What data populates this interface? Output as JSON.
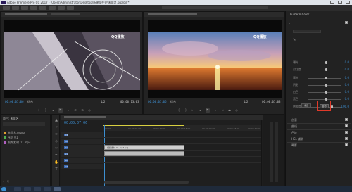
{
  "window": {
    "title": "Adobe Premiere Pro CC 2017 - [Users\\Administrator\\Desktop\\新建文件夹\\未命名.prproj] *"
  },
  "source_monitor": {
    "timecode_left": "00:00:07:06",
    "fit_label": "适合",
    "zoom_label": "1/2",
    "timecode_right": "00:00:13:03",
    "watermark": "QQ播放"
  },
  "program_monitor": {
    "timecode_left": "00:00:07:06",
    "fit_label": "适合",
    "zoom_label": "1/2",
    "timecode_right": "00:00:07:03",
    "watermark": "QQ播放"
  },
  "lumetri": {
    "title": "Lumetri Color",
    "sliders": [
      {
        "label": "曝光",
        "value": "0.0"
      },
      {
        "label": "对比度",
        "value": "0.0"
      },
      {
        "label": "高光",
        "value": "0.0"
      },
      {
        "label": "阴影",
        "value": "0.0"
      },
      {
        "label": "白色",
        "value": "0.0"
      },
      {
        "label": "黑色",
        "value": "0.0"
      },
      {
        "label": "饱和度",
        "value": "100.0"
      }
    ],
    "button_reset": "重置",
    "button_auto": "自动",
    "sections": [
      {
        "label": "创意"
      },
      {
        "label": "曲线"
      },
      {
        "label": "色轮"
      },
      {
        "label": "HSL 辅助"
      },
      {
        "label": "晕影"
      }
    ],
    "highlight_color": "#e03a2a"
  },
  "project": {
    "title": "项目: 未命名",
    "files": [
      {
        "name": "未命名.prproj",
        "color": "#e0a030"
      },
      {
        "name": "序列 01",
        "color": "#4fb04f"
      },
      {
        "name": "视频素材 01.mp4",
        "color": "#b060c0"
      }
    ],
    "item_count": "3 个项"
  },
  "timeline": {
    "timecode": "00:00:07:06",
    "ruler_labels": [
      "00:00",
      "00:00:05:00",
      "00:00:10:00",
      "00:00:15:00",
      "00:00:20:00",
      "00:00:25:00",
      "00:00:30:00"
    ],
    "tracks": [
      {
        "name": "V3"
      },
      {
        "name": "V2"
      },
      {
        "name": "V1"
      },
      {
        "name": "A1"
      },
      {
        "name": "A2"
      },
      {
        "name": "A3"
      }
    ],
    "clip_label": "视频素材 01.mp4 [V]"
  },
  "colors": {
    "accent": "#3d8fd1",
    "panel": "#232323"
  }
}
